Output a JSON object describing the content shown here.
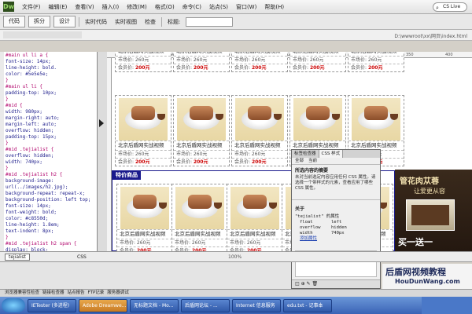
{
  "menubar": {
    "logo": "Dw",
    "items": [
      "文件(F)",
      "编辑(E)",
      "查看(V)",
      "插入(I)",
      "修改(M)",
      "格式(O)",
      "命令(C)",
      "站点(S)",
      "窗口(W)",
      "帮助(H)"
    ],
    "right_label": "CS Live"
  },
  "toolbar": {
    "doc_tab": "代码",
    "split_label": "拆分",
    "design_label": "设计",
    "live_code_label": "实时代码",
    "live_view_label": "实时视图",
    "inspect_label": "检查",
    "title_label": "标题:"
  },
  "pathbar": {
    "path": "D:\\wwwroot\\xx\\网页\\index.html"
  },
  "code_lines": [
    {
      "text": "#main ul li a {",
      "kind": "sel"
    },
    {
      "text": "  font-size: 14px;",
      "kind": "prop"
    },
    {
      "text": "  line-height: bold.",
      "kind": "prop"
    },
    {
      "text": "  color: #5e5e5e;",
      "kind": "prop"
    },
    {
      "text": "}",
      "kind": "close"
    },
    {
      "text": "#main ul li {",
      "kind": "sel"
    },
    {
      "text": "  padding-top: 10px;",
      "kind": "prop"
    },
    {
      "text": "}",
      "kind": "close"
    },
    {
      "text": "#mid {",
      "kind": "sel"
    },
    {
      "text": "  width: 980px;",
      "kind": "prop"
    },
    {
      "text": "  margin-right: auto;",
      "kind": "prop"
    },
    {
      "text": "  margin-left: auto;",
      "kind": "prop"
    },
    {
      "text": "  overflow: hidden;",
      "kind": "prop"
    },
    {
      "text": "  padding-top: 15px;",
      "kind": "prop"
    },
    {
      "text": "}",
      "kind": "close"
    },
    {
      "text": "#mid .tejialist {",
      "kind": "sel"
    },
    {
      "text": "  overflow: hidden;",
      "kind": "prop"
    },
    {
      "text": "  width: 740px;",
      "kind": "prop"
    },
    {
      "text": "}",
      "kind": "close"
    },
    {
      "text": "#mid .tejialist h2 {",
      "kind": "sel"
    },
    {
      "text": "  background-image:",
      "kind": "prop"
    },
    {
      "text": "   url(../images/h2.jpg);",
      "kind": "prop"
    },
    {
      "text": "  background-repeat: repeat-x;",
      "kind": "prop"
    },
    {
      "text": "  background-position: left top;",
      "kind": "prop"
    },
    {
      "text": "  font-size: 14px;",
      "kind": "prop"
    },
    {
      "text": "  font-weight: bold;",
      "kind": "prop"
    },
    {
      "text": "  color: #c8550d;",
      "kind": "prop"
    },
    {
      "text": "  line-height: 1.8em;",
      "kind": "prop"
    },
    {
      "text": "  text-indent: 8px;",
      "kind": "prop"
    },
    {
      "text": "}",
      "kind": "close"
    },
    {
      "text": "#mid .tejialist h2 span {",
      "kind": "sel"
    },
    {
      "text": "  display: block;",
      "kind": "prop"
    }
  ],
  "products": [
    {
      "name": "北京后盾网实战视频",
      "price_label": "市场价: 260元",
      "member_label": "会员价:",
      "member_price": "200元"
    },
    {
      "name": "北京后盾网实战视频",
      "price_label": "市场价: 260元",
      "member_label": "会员价:",
      "member_price": "200元"
    },
    {
      "name": "北京后盾网实战视频",
      "price_label": "市场价: 260元",
      "member_label": "会员价:",
      "member_price": "200元"
    },
    {
      "name": "北京后盾网实战视频",
      "price_label": "市场价: 260元",
      "member_label": "会员价:",
      "member_price": "200元"
    },
    {
      "name": "北京后盾网实战视频",
      "price_label": "市场价: 260元",
      "member_label": "会员价:",
      "member_price": "200元"
    }
  ],
  "section_title": "特价商品",
  "ad": {
    "line1": "管花肉苁蓉",
    "line2": "让爱更从容",
    "line3": "买一送一"
  },
  "css_panel": {
    "tabs": [
      "标签检查器",
      "CSS 样式"
    ],
    "subtabs": [
      "全部",
      "当前"
    ],
    "heading": "所选内容的摘要",
    "desc": "未对当前选定内容应用任何 CSS 属性。请选择一个带样式的元素，查看应用了哪些 CSS 属性。",
    "about_label": "关于",
    "rule": "\"tejialist\" 的属性",
    "props": [
      {
        "key": "float",
        "value": "left"
      },
      {
        "key": "overflow",
        "value": "hidden"
      },
      {
        "key": "width",
        "value": "740px"
      }
    ],
    "add_prop": "添加属性"
  },
  "tagbar": {
    "tag": "tejialist",
    "css_label": "CSS",
    "zoom": "100%"
  },
  "watermark": {
    "line1": "后盾网视频教程",
    "line2": "HouDunWang.com"
  },
  "panel_tabs": [
    "浏览器兼容性检查",
    "链接检查器",
    "站点报告",
    "FTP记录",
    "服务器调试"
  ],
  "taskbar": [
    {
      "label": "IETester (多进程)",
      "active": false
    },
    {
      "label": "Adobe Dreamwe...",
      "active": true
    },
    {
      "label": "无标题文档 - Mo...",
      "active": false
    },
    {
      "label": "后盾网论坛 - ...",
      "active": false
    },
    {
      "label": "Internet 信息服务",
      "active": false
    },
    {
      "label": "edu.txt - 记事本",
      "active": false
    }
  ]
}
